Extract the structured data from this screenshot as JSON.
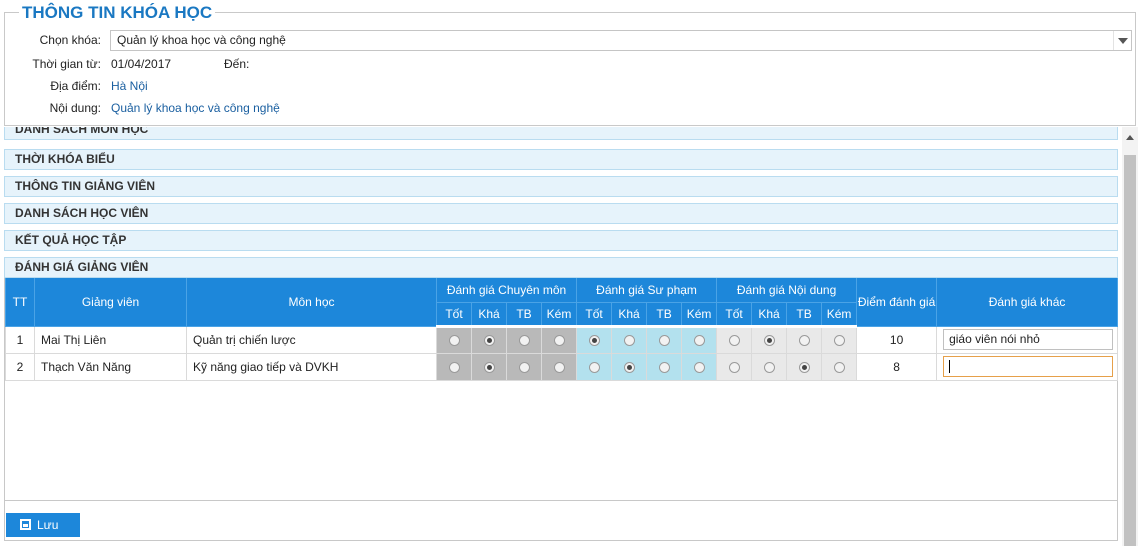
{
  "course_info": {
    "title": "THÔNG TIN KHÓA HỌC",
    "select_label": "Chọn khóa:",
    "select_value": "Quản lý khoa học và công nghệ",
    "from_label": "Thời gian từ:",
    "from_value": "01/04/2017",
    "to_label": "Đến:",
    "location_label": "Địa điểm:",
    "location_value": "Hà Nội",
    "content_label": "Nội dung:",
    "content_value": "Quản lý khoa học và công nghệ"
  },
  "sections": {
    "subjects": "DANH SÁCH MÔN HỌC",
    "timetable": "THỜI KHÓA BIỂU",
    "teacher_info": "THÔNG TIN GIẢNG VIÊN",
    "students": "DANH SÁCH HỌC VIÊN",
    "results": "KẾT QUẢ HỌC TẬP",
    "evaluation": "ĐÁNH GIÁ GIẢNG VIÊN"
  },
  "table": {
    "headers": {
      "tt": "TT",
      "teacher": "Giảng viên",
      "subject": "Môn học",
      "expertise": "Đánh giá Chuyên môn",
      "pedagogy": "Đánh giá Sư phạm",
      "content": "Đánh giá Nội dung",
      "score": "Điểm đánh giá",
      "other": "Đánh giá khác"
    },
    "levels": [
      "Tốt",
      "Khá",
      "TB",
      "Kém"
    ],
    "rows": [
      {
        "tt": "1",
        "teacher": "Mai Thị Liên",
        "subject": "Quản trị chiến lược",
        "expertise": 1,
        "pedagogy": 0,
        "content": 1,
        "score": "10",
        "other": "giáo viên nói nhỏ"
      },
      {
        "tt": "2",
        "teacher": "Thạch Văn Năng",
        "subject": "Kỹ năng giao tiếp và DVKH",
        "expertise": 1,
        "pedagogy": 1,
        "content": 2,
        "score": "8",
        "other": ""
      }
    ]
  },
  "save_label": "Lưu",
  "colors": {
    "accent": "#1d87da",
    "title": "#1a78c2",
    "section_bg": "#e6f3fb",
    "expertise_bg": "#b9b9b9",
    "pedagogy_bg": "#b3e1ee",
    "content_bg": "#e9e9e9"
  }
}
